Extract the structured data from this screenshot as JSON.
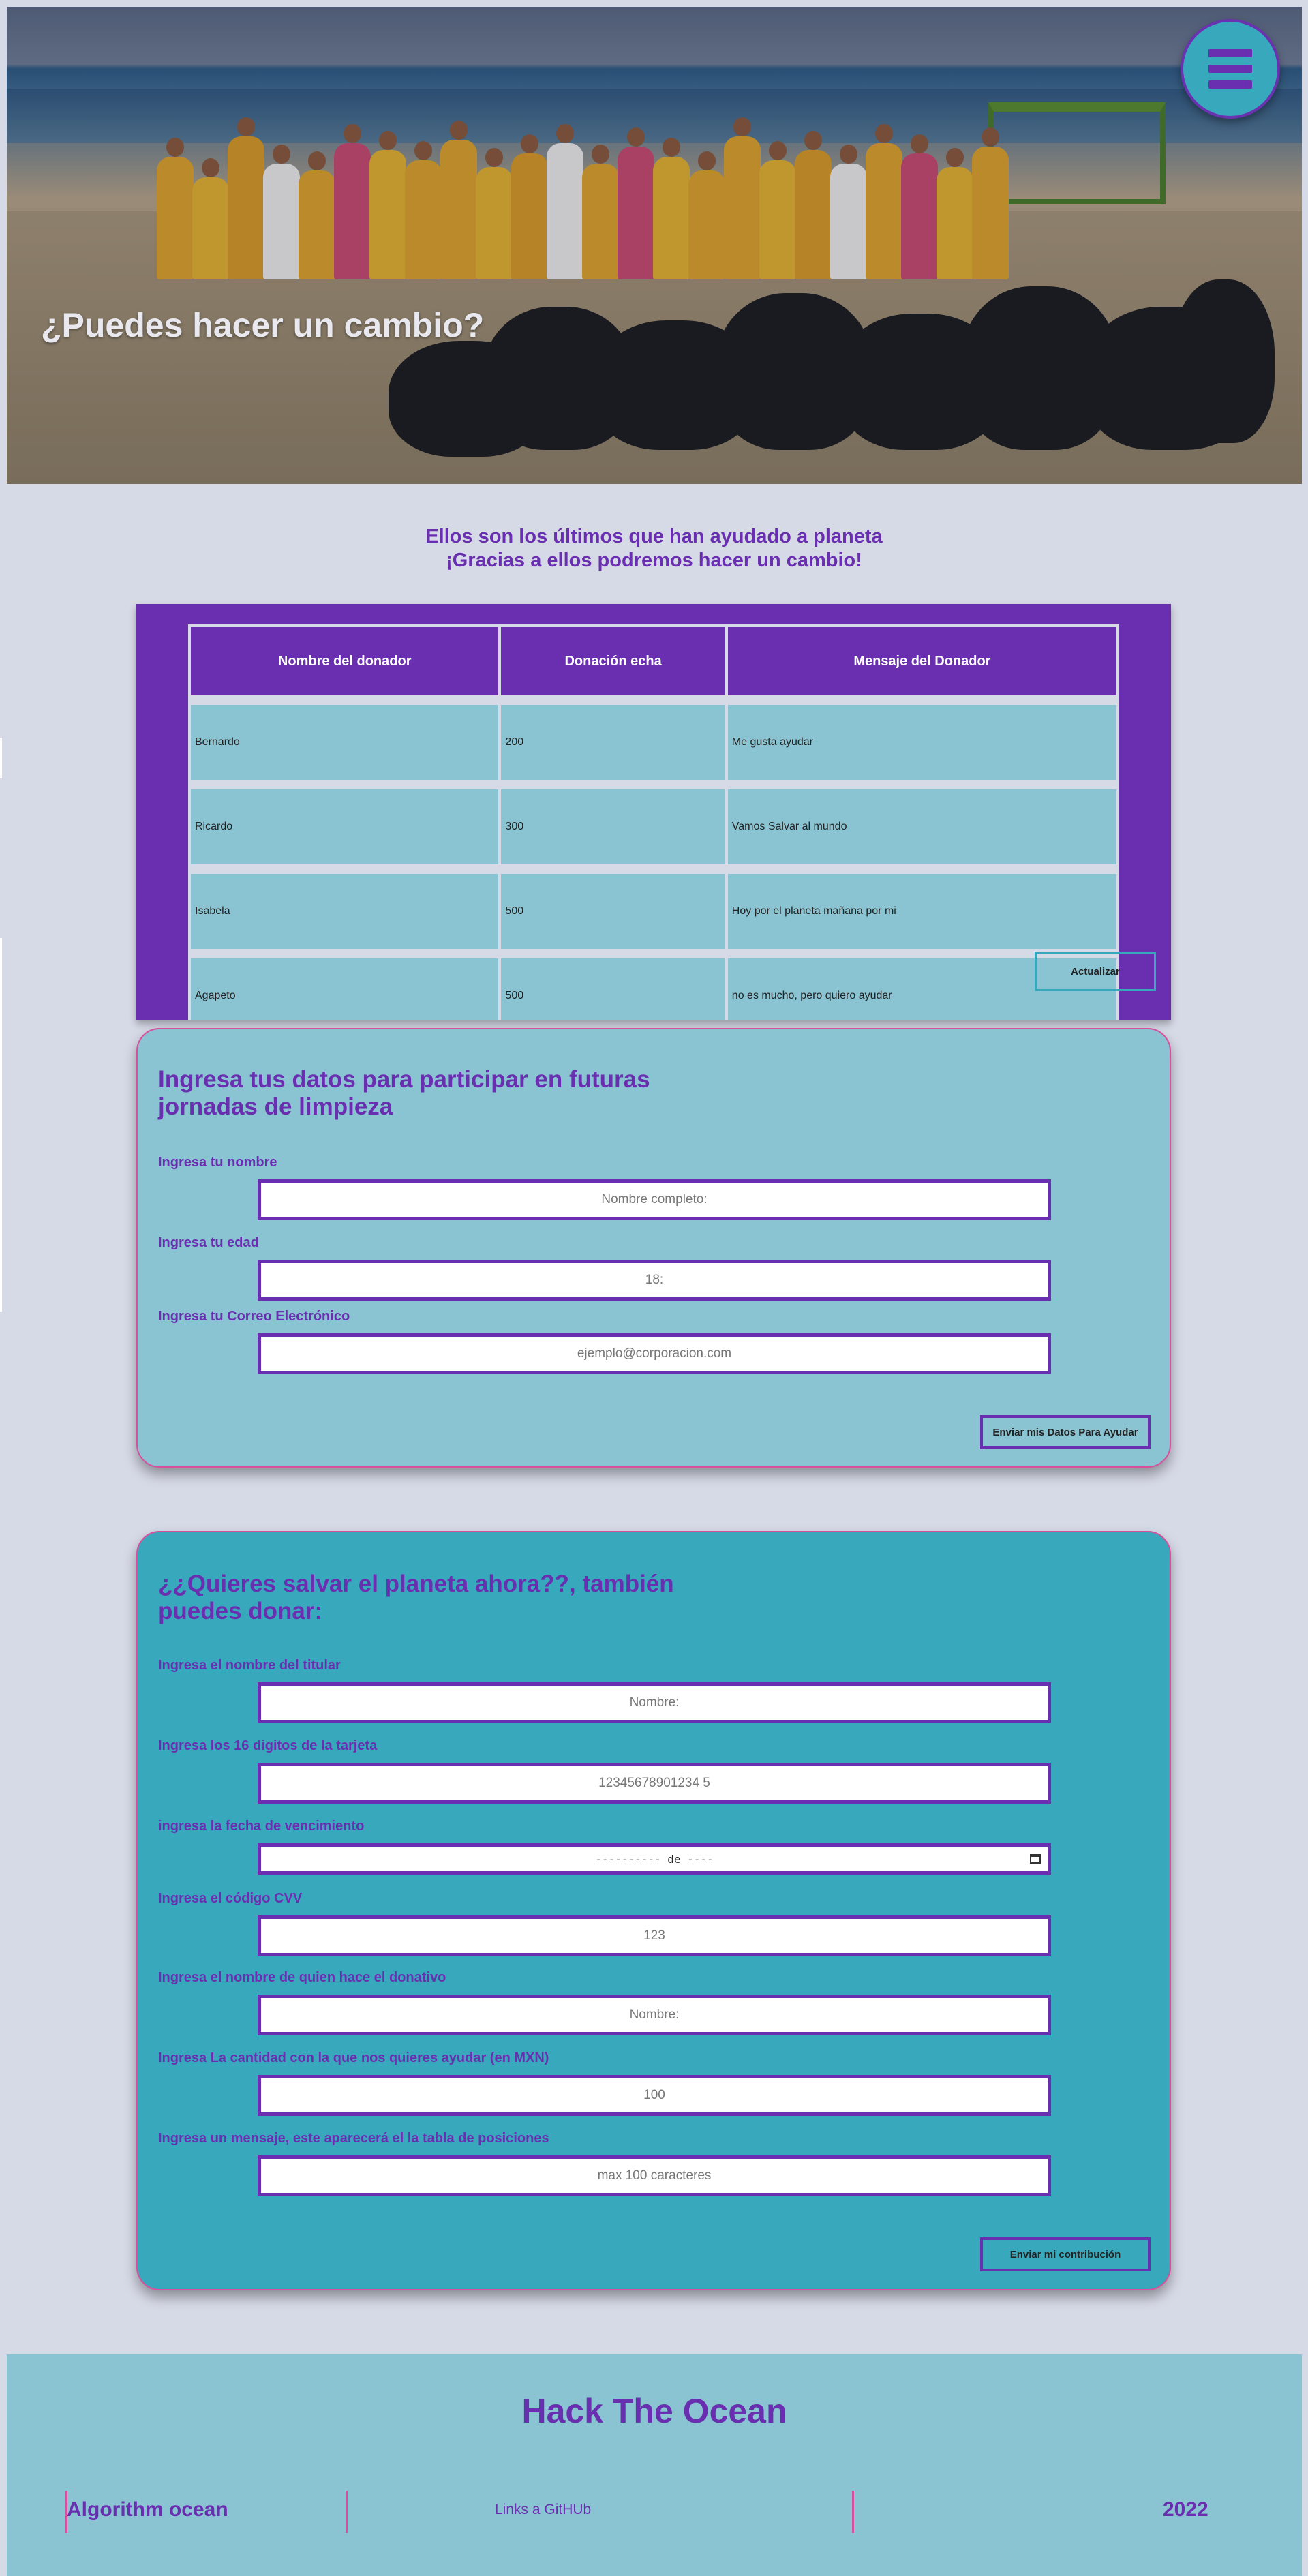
{
  "hero": {
    "title": "¿Puedes hacer un cambio?",
    "menu_icon": "hamburger-menu-icon"
  },
  "intro": {
    "line1": "Ellos son los últimos que han ayudado a planeta",
    "line2": "¡Gracias a ellos podremos hacer un cambio!"
  },
  "donors_table": {
    "headers": [
      "Nombre del donador",
      "Donación echa",
      "Mensaje del Donador"
    ],
    "rows": [
      [
        "Bernardo",
        "200",
        "Me gusta ayudar"
      ],
      [
        "Ricardo",
        "300",
        "Vamos Salvar al mundo"
      ],
      [
        "Isabela",
        "500",
        "Hoy por el planeta mañana por mi"
      ],
      [
        "Agapeto",
        "500",
        "no es mucho, pero quiero ayudar"
      ]
    ],
    "update_label": "Actualizar"
  },
  "volunteer_form": {
    "title": "Ingresa tus datos para participar en futuras jornadas de limpieza",
    "name_label": "Ingresa tu nombre",
    "name_placeholder": "Nombre completo:",
    "age_label": "Ingresa tu edad",
    "age_placeholder": "18:",
    "email_label": "Ingresa tu Correo Electrónico",
    "email_placeholder": "ejemplo@corporacion.com",
    "submit_label": "Enviar mis Datos Para Ayudar"
  },
  "donation_form": {
    "title": "¿¿Quieres salvar el planeta ahora??, también puedes donar:",
    "holder_label": "Ingresa el nombre del titular",
    "holder_placeholder": "Nombre:",
    "card_label": "Ingresa los 16 digitos de la tarjeta",
    "card_placeholder": "12345678901234 5",
    "expiry_label": "ingresa la fecha de vencimiento",
    "expiry_value": "---------- de ----",
    "cvv_label": "Ingresa el código CVV",
    "cvv_placeholder": "123",
    "donor_label": "Ingresa el nombre de quien hace el donativo",
    "donor_placeholder": "Nombre:",
    "amount_label": "Ingresa La cantidad con la que nos quieres ayudar (en MXN)",
    "amount_placeholder": "100",
    "message_label": "Ingresa un mensaje, este aparecerá el la tabla de posiciones",
    "message_placeholder": "max 100 caracteres",
    "submit_label": "Enviar mi contribución"
  },
  "footer": {
    "title": "Hack The Ocean",
    "brand": "Algorithm ocean",
    "link": "Links a GitHUb",
    "year": "2022"
  },
  "colors": {
    "purple": "#6a2fb0",
    "teal": "#38a9bd",
    "light_teal": "#8ac4d2",
    "pink": "#d84f9e",
    "page_bg": "#d6d9e6"
  }
}
